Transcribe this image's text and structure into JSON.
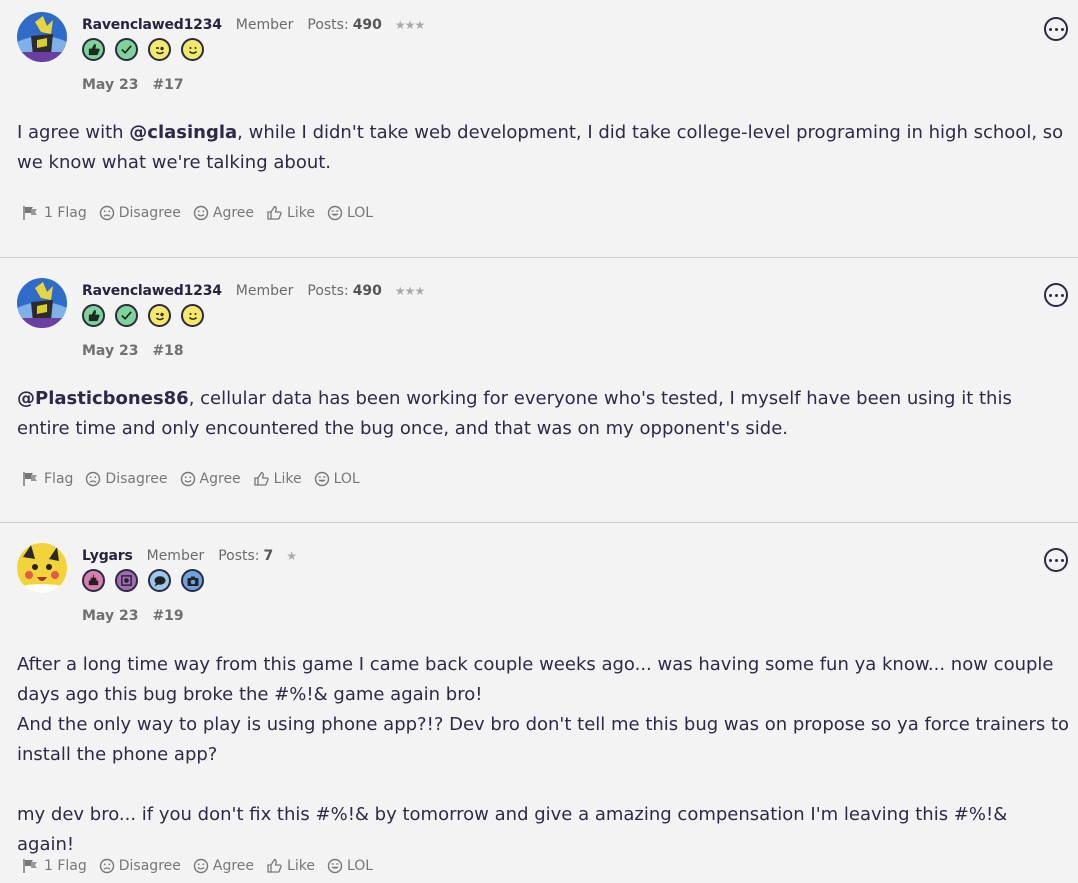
{
  "posts": [
    {
      "author": "Ravenclawed1234",
      "role": "Member",
      "posts_label": "Posts:",
      "posts_count": "490",
      "stars": "★★★",
      "date": "May 23",
      "number": "#17",
      "badges": [
        "thumb-up-icon",
        "check-icon",
        "wink-icon",
        "smile-icon"
      ],
      "body": {
        "pre": "I agree with ",
        "mention": "@clasingla",
        "post": ", while I didn't take web development, I did take college-level programing in high school, so we know what we're talking about."
      },
      "actions": {
        "flag": "1 Flag",
        "disagree": "Disagree",
        "agree": "Agree",
        "like": "Like",
        "lol": "LOL"
      }
    },
    {
      "author": "Ravenclawed1234",
      "role": "Member",
      "posts_label": "Posts:",
      "posts_count": "490",
      "stars": "★★★",
      "date": "May 23",
      "number": "#18",
      "badges": [
        "thumb-up-icon",
        "check-icon",
        "wink-icon",
        "smile-icon"
      ],
      "body": {
        "mention": "@Plasticbones86",
        "post": ", cellular data has been working for everyone who's tested, I myself have been using it this entire time and only encountered the bug once, and that was on my opponent's side."
      },
      "actions": {
        "flag": "Flag",
        "disagree": "Disagree",
        "agree": "Agree",
        "like": "Like",
        "lol": "LOL"
      }
    },
    {
      "author": "Lygars",
      "role": "Member",
      "posts_label": "Posts:",
      "posts_count": "7",
      "stars": "★",
      "date": "May 23",
      "number": "#19",
      "badges": [
        "cake-icon",
        "photo-frame-icon",
        "chat-bubble-icon",
        "camera-icon"
      ],
      "body": {
        "line1": "After a long time way from this game I came back couple weeks ago... was having some fun ya know... now couple days ago this bug broke the #%!& game again bro!",
        "line2": "And the only way to play is using phone app?!? Dev bro don't tell me this bug was on propose so ya force trainers to install the phone app?",
        "line3": "my dev bro... if you don't fix this #%!& by tomorrow and give a amazing compensation I'm leaving this #%!& again!"
      },
      "actions": {
        "flag": "1 Flag",
        "disagree": "Disagree",
        "agree": "Agree",
        "like": "Like",
        "lol": "LOL"
      }
    }
  ],
  "colors": {
    "badge_green": "#7fd39a",
    "badge_yellow": "#f6e96a",
    "badge_pink": "#d67fb0",
    "badge_purple": "#a36bb5",
    "badge_blue": "#9cc8ec",
    "badge_camera": "#6fa3e0"
  }
}
